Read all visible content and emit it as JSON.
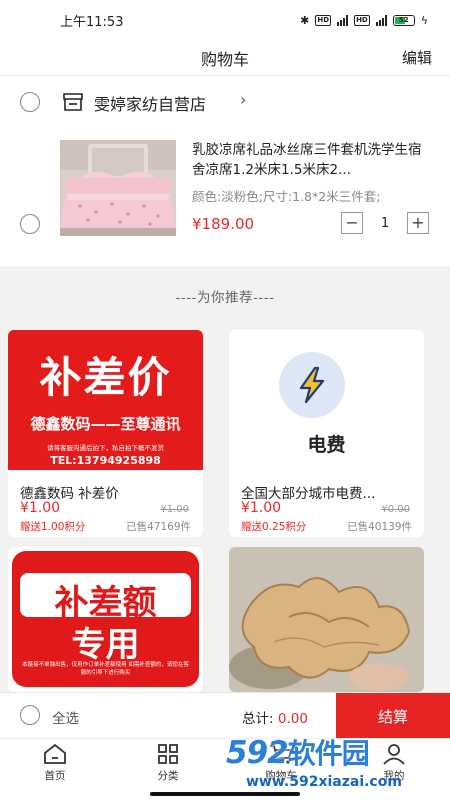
{
  "status_bar": {
    "time": "上午11:53",
    "battery": "52"
  },
  "nav": {
    "title": "购物车",
    "edit": "编辑"
  },
  "store": {
    "name": "雯婷家纺自营店",
    "chevron": "›"
  },
  "product": {
    "title": "乳胶凉席礼品冰丝席三件套机洗学生宿舍凉席1.2米床1.5米床2...",
    "spec": "颜色:淡粉色;尺寸:1.8*2米三件套;",
    "price": "¥189.00",
    "minus": "−",
    "quantity": "1",
    "plus": "+"
  },
  "recommend": {
    "title": "----为你推荐----",
    "items": [
      {
        "name": "德鑫数码 补差价",
        "price": "¥1.00",
        "old_price": "¥1.00",
        "points": "赠送1.00积分",
        "sold": "已售47169件",
        "banner_main": "补差价",
        "banner_sub": "德鑫数码——至尊通讯",
        "banner_note": "请将客服沟通后拍下，私自拍下概不发货",
        "banner_tel": "TEL:13794925898"
      },
      {
        "name": "全国大部分城市电费...",
        "price": "¥1.00",
        "old_price": "¥0.00",
        "points": "赠送0.25积分",
        "sold": "已售40139件",
        "banner_main": "电费"
      },
      {
        "banner_line1": "补差额",
        "banner_line2": "专用",
        "banner_note": "本链接不单独出售，仅用作订单补差额使用 如需补差额的，请您在客服的引导下进行购买"
      },
      {}
    ]
  },
  "bottom_bar": {
    "select_all": "全选",
    "total_label": "总计:",
    "total_amount": "0.00",
    "checkout": "结算"
  },
  "tabs": [
    {
      "label": "首页",
      "icon": "home-icon"
    },
    {
      "label": "分类",
      "icon": "grid-icon"
    },
    {
      "label": "购物车",
      "icon": "cart-icon"
    },
    {
      "label": "我的",
      "icon": "user-icon"
    }
  ],
  "watermark": {
    "logo_num": "592",
    "logo_cn": "软件园",
    "url": "www.592xiazai.com"
  },
  "colors": {
    "accent": "#e52a2a",
    "checkout_bg": "#e62424",
    "watermark": "#2a7fd9"
  }
}
